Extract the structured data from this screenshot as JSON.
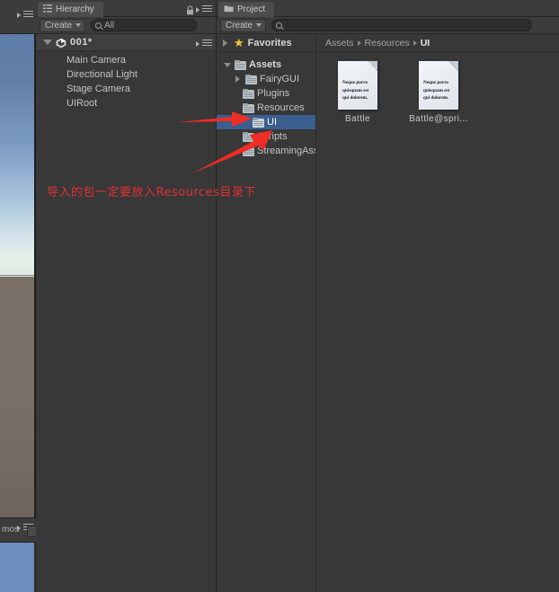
{
  "scene_view": {
    "gizmos_tab_label": "mos",
    "menu_icon": "hamburger-menu-icon"
  },
  "hierarchy": {
    "tab_label": "Hierarchy",
    "tab_icon": "hierarchy-icon",
    "lock_icon": "lock-icon",
    "menu_icon": "hamburger-menu-icon",
    "create_label": "Create",
    "search_value": "All",
    "search_icon": "search-icon",
    "scene": {
      "name": "001*",
      "icon": "unity-scene-icon",
      "expanded": true
    },
    "objects": [
      {
        "label": "Main Camera"
      },
      {
        "label": "Directional Light"
      },
      {
        "label": "Stage Camera"
      },
      {
        "label": "UIRoot"
      }
    ]
  },
  "project": {
    "tab_label": "Project",
    "tab_icon": "folder-icon",
    "create_label": "Create",
    "search_value": "",
    "search_icon": "search-icon",
    "favorites": {
      "label": "Favorites",
      "icon": "star-icon",
      "expanded": false
    },
    "breadcrumb": [
      "Assets",
      "Resources",
      "UI"
    ],
    "tree": [
      {
        "label": "Assets",
        "depth": 0,
        "expanded": true,
        "has_children": true,
        "selected": false
      },
      {
        "label": "FairyGUI",
        "depth": 1,
        "expanded": false,
        "has_children": true,
        "selected": false
      },
      {
        "label": "Plugins",
        "depth": 1,
        "expanded": false,
        "has_children": false,
        "selected": false
      },
      {
        "label": "Resources",
        "depth": 1,
        "expanded": false,
        "has_children": false,
        "selected": false
      },
      {
        "label": "UI",
        "depth": 2,
        "expanded": false,
        "has_children": false,
        "selected": true
      },
      {
        "label": "Scripts",
        "depth": 1,
        "expanded": false,
        "has_children": false,
        "selected": false
      },
      {
        "label": "StreamingAssets",
        "depth": 1,
        "expanded": false,
        "has_children": false,
        "selected": false
      }
    ],
    "assets": [
      {
        "label": "Battle",
        "thumb_text": "Neque porro quisquam est qui dolorem.",
        "icon": "text-asset-icon"
      },
      {
        "label": "Battle@spri...",
        "thumb_text": "Neque porro quisquam est qui dolorem.",
        "icon": "text-asset-icon"
      }
    ]
  },
  "annotations": {
    "note_text": "导入的包一定要放入Resources目录下",
    "note_color": "#e03131",
    "arrow_color": "#ee2d24",
    "arrow_count": 2
  },
  "colors": {
    "selection_blue": "#3a5f8f",
    "panel_bg": "#383838",
    "toolbar_bg": "#3c3c3c",
    "text": "#c4c4c4",
    "star_yellow": "#e8c13a"
  }
}
